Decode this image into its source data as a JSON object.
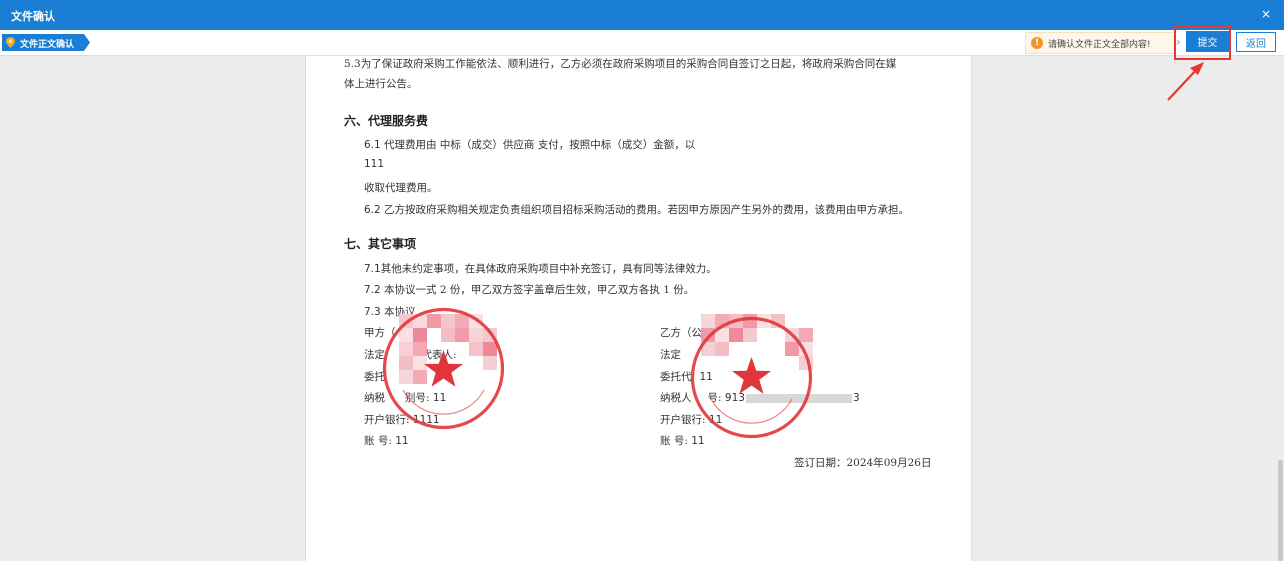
{
  "window": {
    "title": "文件确认",
    "close_label": "×"
  },
  "toolbar": {
    "breadcrumb": "文件正文确认",
    "notice": "请确认文件正文全部内容!",
    "submit_label": "提交",
    "back_label": "返回"
  },
  "document": {
    "p53_line1": "5.3为了保证政府采购工作能依法、顺利进行，乙方必须在政府采购项目的采购合同自签订之日起，将政府采购合同在媒",
    "p53_line2": "体上进行公告。",
    "sec6_title": "六、代理服务费",
    "p61_num": "6.1",
    "p61_text": " 代理费用由 中标（成交）供应商 支付，按照中标（成交）金额，以",
    "fee_value": "111",
    "p61_tail": "收取代理费用。",
    "p62_num": "6.2",
    "p62_text": " 乙方按政府采购相关规定负责组织项目招标采购活动的费用。若因甲方原因产生另外的费用，该费用由甲方承担。",
    "sec7_title": "七、其它事项",
    "p71_num": "7.1",
    "p71_text": "其他未约定事项，在具体政府采购项目中补充签订，具有同等法律效力。",
    "p72_num": "7.2",
    "p72_text": " 本协议一式 2 份，甲乙双方签字盖章后生效，甲乙双方各执 1 份。",
    "p73_num": "7.3",
    "p73_text": " 本协议",
    "party_a": {
      "label": "甲方（",
      "rep": "法定",
      "rep_tail": "）代表人:",
      "agent": "委托",
      "agent_tail": "人:",
      "tax": "纳税",
      "tax_tail": "别号:",
      "tax_value": "11",
      "bank": "开户银行:",
      "bank_value": "1111",
      "account": "账    号:",
      "account_value": "11"
    },
    "party_b": {
      "label": "乙方（公章",
      "rep": "法定",
      "agent": "委托代",
      "agent_value": "11",
      "tax": "纳税人",
      "tax_mid": "号:",
      "tax_value_head": "913",
      "tax_value_tail": "3",
      "bank": "开户银行:",
      "bank_value": "11",
      "account": "账    号:",
      "account_value": "11"
    },
    "sign_date": "签订日期：2024年09月26日"
  },
  "colors": {
    "accent": "#1a7fd4",
    "seal": "#e0353a",
    "highlight": "#e8352f",
    "warning": "#f39424"
  }
}
